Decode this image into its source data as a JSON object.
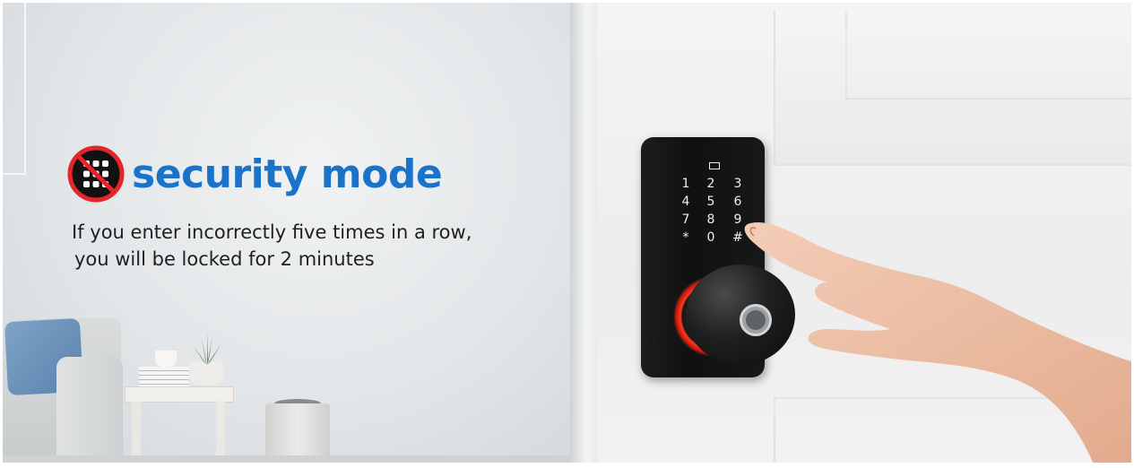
{
  "headline": {
    "title": "security mode",
    "icon": "no-keypad-icon",
    "title_color": "#1a73c9",
    "icon_color": "#e3262b"
  },
  "description": {
    "line1": "If you enter incorrectly five times in a row,",
    "line2": "you will be locked for 2 minutes"
  },
  "keypad": {
    "keys": [
      "1",
      "2",
      "3",
      "4",
      "5",
      "6",
      "7",
      "8",
      "9",
      "*",
      "0",
      "#"
    ]
  }
}
